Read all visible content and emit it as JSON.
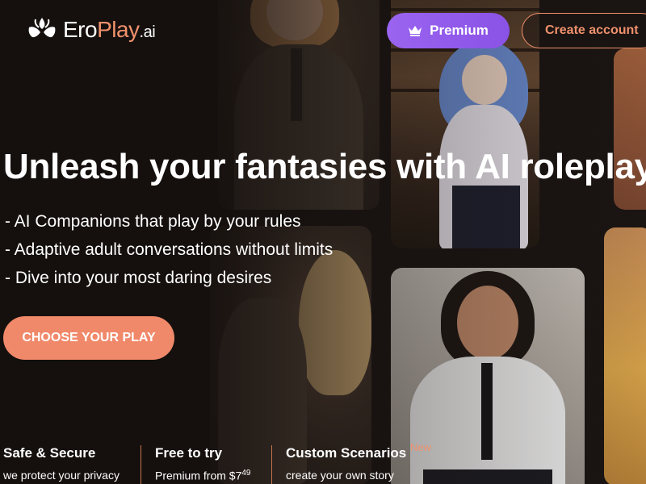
{
  "header": {
    "logo": {
      "part1": "Ero",
      "part2": "Play",
      "part3": ".ai"
    },
    "premium_label": "Premium",
    "create_account_label": "Create account"
  },
  "hero": {
    "title": "Unleash your fantasies with AI roleplay",
    "features": [
      "- AI Companions that play by your rules",
      "- Adaptive adult conversations without limits",
      "- Dive into your most daring desires"
    ],
    "cta_label": "CHOOSE YOUR PLAY"
  },
  "stats": [
    {
      "title": "Safe & Secure",
      "subtitle": "we protect your privacy"
    },
    {
      "title": "Free to try",
      "subtitle_prefix": "Premium from $7",
      "subtitle_superscript": "49"
    },
    {
      "title": "Custom Scenarios",
      "badge": "New",
      "subtitle": "create your own story"
    }
  ],
  "colors": {
    "background": "#1a1412",
    "accent": "#f0916c",
    "premium": "#9a64f0",
    "cta": "#f0896a"
  },
  "icons": {
    "logo": "flame-mask-icon",
    "premium": "crown-icon"
  }
}
